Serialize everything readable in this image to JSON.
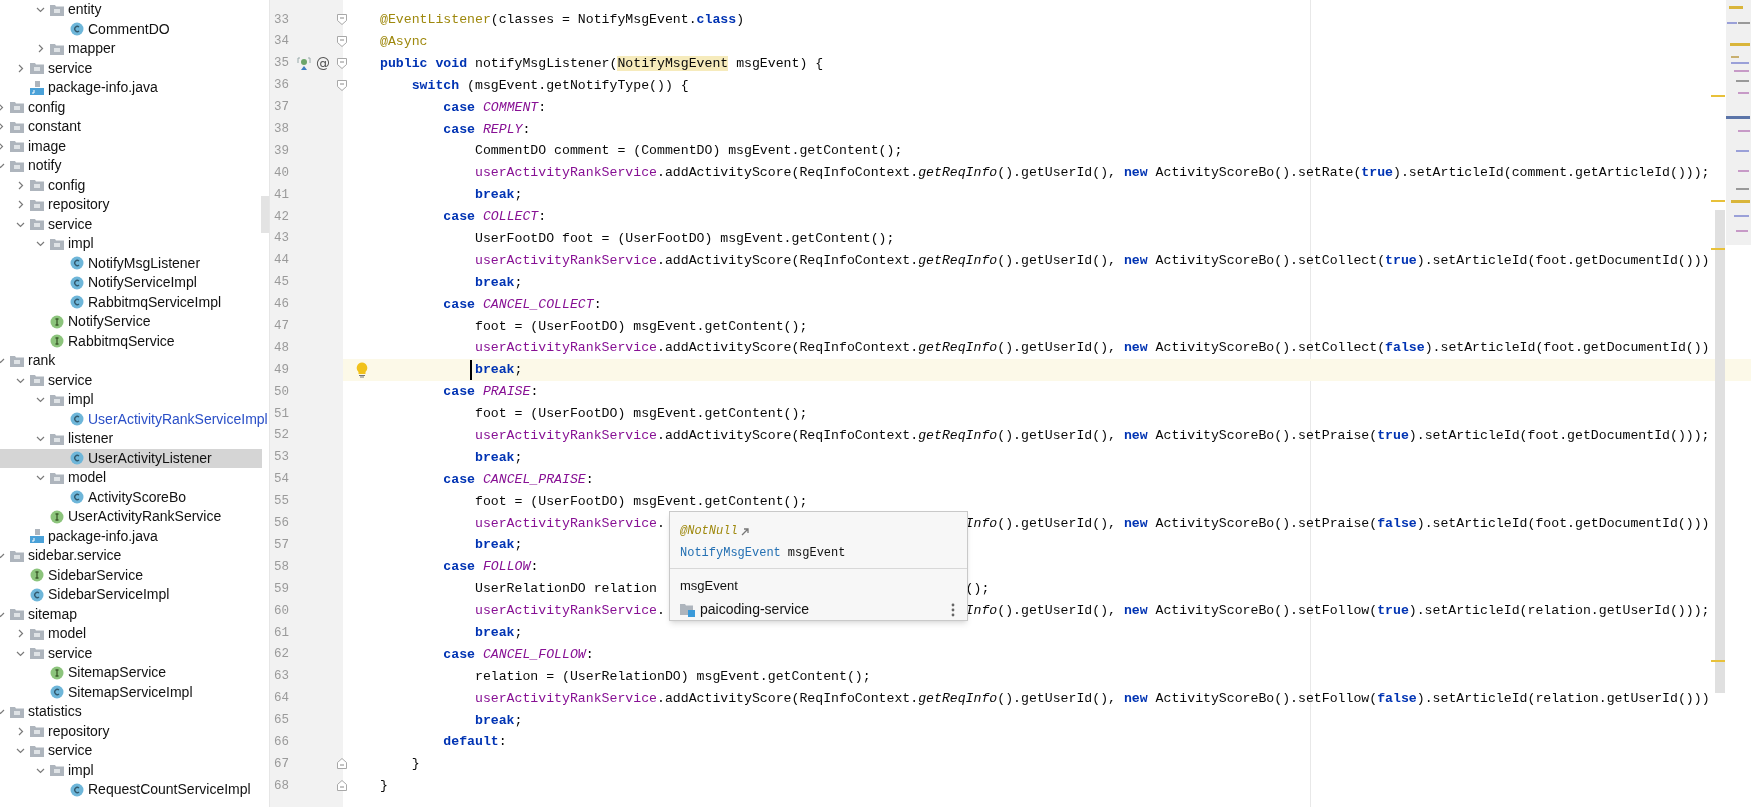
{
  "project_tree": [
    {
      "children": [
        {
          "children": [
            {
              "label": "entity",
              "kind": "folder",
              "expanded": true,
              "selected": false,
              "modified": false,
              "children": [
                {
                  "label": "CommentDO",
                  "kind": "class",
                  "selected": false,
                  "modified": false
                }
              ]
            },
            {
              "label": "mapper",
              "kind": "folder",
              "expanded": false,
              "selected": false,
              "modified": false
            }
          ]
        },
        {
          "label": "service",
          "kind": "folder",
          "expanded": false,
          "selected": false,
          "modified": false
        },
        {
          "label": "package-info.java",
          "kind": "file",
          "selected": false,
          "modified": false
        }
      ]
    },
    {
      "label": "config",
      "kind": "folder",
      "expanded": false,
      "selected": false,
      "modified": false
    },
    {
      "label": "constant",
      "kind": "folder",
      "expanded": false,
      "selected": false,
      "modified": false
    },
    {
      "label": "image",
      "kind": "folder",
      "expanded": false,
      "selected": false,
      "modified": false
    },
    {
      "label": "notify",
      "kind": "folder",
      "expanded": true,
      "selected": false,
      "modified": false,
      "children": [
        {
          "label": "config",
          "kind": "folder",
          "expanded": false,
          "selected": false,
          "modified": false
        },
        {
          "label": "repository",
          "kind": "folder",
          "expanded": false,
          "selected": false,
          "modified": false
        },
        {
          "label": "service",
          "kind": "folder",
          "expanded": true,
          "selected": false,
          "modified": false,
          "children": [
            {
              "label": "impl",
              "kind": "folder",
              "expanded": true,
              "selected": false,
              "modified": false,
              "children": [
                {
                  "label": "NotifyMsgListener",
                  "kind": "class",
                  "selected": false,
                  "modified": false
                },
                {
                  "label": "NotifyServiceImpl",
                  "kind": "class",
                  "selected": false,
                  "modified": false
                },
                {
                  "label": "RabbitmqServiceImpl",
                  "kind": "class",
                  "selected": false,
                  "modified": false
                }
              ]
            },
            {
              "label": "NotifyService",
              "kind": "interface",
              "selected": false,
              "modified": false
            },
            {
              "label": "RabbitmqService",
              "kind": "interface",
              "selected": false,
              "modified": false
            }
          ]
        }
      ]
    },
    {
      "label": "rank",
      "kind": "folder",
      "expanded": true,
      "selected": false,
      "modified": false,
      "children": [
        {
          "label": "service",
          "kind": "folder",
          "expanded": true,
          "selected": false,
          "modified": false,
          "children": [
            {
              "label": "impl",
              "kind": "folder",
              "expanded": true,
              "selected": false,
              "modified": false,
              "children": [
                {
                  "label": "UserActivityRankServiceImpl",
                  "kind": "class",
                  "selected": false,
                  "modified": true
                }
              ]
            },
            {
              "label": "listener",
              "kind": "folder",
              "expanded": true,
              "selected": false,
              "modified": false,
              "children": [
                {
                  "label": "UserActivityListener",
                  "kind": "class",
                  "selected": true,
                  "modified": false
                }
              ]
            },
            {
              "label": "model",
              "kind": "folder",
              "expanded": true,
              "selected": false,
              "modified": false,
              "children": [
                {
                  "label": "ActivityScoreBo",
                  "kind": "class",
                  "selected": false,
                  "modified": false
                }
              ]
            },
            {
              "label": "UserActivityRankService",
              "kind": "interface",
              "selected": false,
              "modified": false
            }
          ]
        },
        {
          "label": "package-info.java",
          "kind": "file",
          "selected": false,
          "modified": false
        }
      ]
    },
    {
      "label": "sidebar.service",
      "kind": "folder",
      "expanded": true,
      "selected": false,
      "modified": false,
      "children": [
        {
          "label": "SidebarService",
          "kind": "interface",
          "selected": false,
          "modified": false
        },
        {
          "label": "SidebarServiceImpl",
          "kind": "class",
          "selected": false,
          "modified": false
        }
      ]
    },
    {
      "label": "sitemap",
      "kind": "folder",
      "expanded": true,
      "selected": false,
      "modified": false,
      "children": [
        {
          "label": "model",
          "kind": "folder",
          "expanded": false,
          "selected": false,
          "modified": false
        },
        {
          "label": "service",
          "kind": "folder",
          "expanded": true,
          "selected": false,
          "modified": false,
          "children": [
            {
              "label": "SitemapService",
              "kind": "interface",
              "selected": false,
              "modified": false
            },
            {
              "label": "SitemapServiceImpl",
              "kind": "class",
              "selected": false,
              "modified": false
            }
          ]
        }
      ]
    },
    {
      "label": "statistics",
      "kind": "folder",
      "expanded": true,
      "selected": false,
      "modified": false,
      "children": [
        {
          "label": "repository",
          "kind": "folder",
          "expanded": false,
          "selected": false,
          "modified": false
        },
        {
          "label": "service",
          "kind": "folder",
          "expanded": true,
          "selected": false,
          "modified": false,
          "children": [
            {
              "label": "impl",
              "kind": "folder",
              "expanded": true,
              "selected": false,
              "modified": false,
              "children": [
                {
                  "label": "RequestCountServiceImpl",
                  "kind": "class",
                  "selected": false,
                  "modified": false
                }
              ]
            }
          ]
        }
      ]
    }
  ],
  "editor": {
    "lines": [
      {
        "number": "33",
        "current": false,
        "fold_open": true,
        "code": [
          {
            "text": "@EventListener",
            "kind": "annotation"
          },
          {
            "text": "(classes = NotifyMsgEvent.",
            "kind": "plain"
          },
          {
            "text": "class",
            "kind": "keyword"
          },
          {
            "text": ")",
            "kind": "plain"
          }
        ]
      },
      {
        "number": "34",
        "current": false,
        "fold_open": true,
        "code": [
          {
            "text": "@Async",
            "kind": "annotation"
          }
        ]
      },
      {
        "number": "35",
        "current": false,
        "fold_open": true,
        "gutter_mark": "@",
        "code": [
          {
            "text": "public void ",
            "kind": "keyword"
          },
          {
            "text": "notifyMsgListener(",
            "kind": "plain"
          },
          {
            "text": "NotifyMsgEvent",
            "kind": "highlight"
          },
          {
            "text": " msgEvent) {",
            "kind": "plain"
          }
        ]
      },
      {
        "number": "36",
        "current": false,
        "fold_open": true,
        "code": [
          {
            "text": "    switch",
            "kind": "keyword"
          },
          {
            "text": " (msgEvent.getNotifyType()) {",
            "kind": "plain"
          }
        ]
      },
      {
        "number": "37",
        "current": false,
        "code": [
          {
            "text": "        case ",
            "kind": "keyword"
          },
          {
            "text": "COMMENT",
            "kind": "constant"
          },
          {
            "text": ":",
            "kind": "plain"
          }
        ]
      },
      {
        "number": "38",
        "current": false,
        "code": [
          {
            "text": "        case ",
            "kind": "keyword"
          },
          {
            "text": "REPLY",
            "kind": "constant"
          },
          {
            "text": ":",
            "kind": "plain"
          }
        ]
      },
      {
        "number": "39",
        "current": false,
        "code": [
          {
            "text": "            CommentDO comment = (CommentDO) msgEvent.getContent();",
            "kind": "plain"
          }
        ]
      },
      {
        "number": "40",
        "current": false,
        "code": [
          {
            "text": "            userActivityRankService",
            "kind": "field"
          },
          {
            "text": ".addActivityScore(ReqInfoContext.",
            "kind": "plain"
          },
          {
            "text": "getReqInfo",
            "kind": "static"
          },
          {
            "text": "().getUserId(), ",
            "kind": "plain"
          },
          {
            "text": "new ",
            "kind": "keyword"
          },
          {
            "text": "ActivityScoreBo().setRate(",
            "kind": "plain"
          },
          {
            "text": "true",
            "kind": "keyword"
          },
          {
            "text": ").setArticleId(comment.getArticleId()));",
            "kind": "plain"
          }
        ]
      },
      {
        "number": "41",
        "current": false,
        "code": [
          {
            "text": "            break",
            "kind": "keyword"
          },
          {
            "text": ";",
            "kind": "plain"
          }
        ]
      },
      {
        "number": "42",
        "current": false,
        "code": [
          {
            "text": "        case ",
            "kind": "keyword"
          },
          {
            "text": "COLLECT",
            "kind": "constant"
          },
          {
            "text": ":",
            "kind": "plain"
          }
        ]
      },
      {
        "number": "43",
        "current": false,
        "code": [
          {
            "text": "            UserFootDO foot = (UserFootDO) msgEvent.getContent();",
            "kind": "plain"
          }
        ]
      },
      {
        "number": "44",
        "current": false,
        "code": [
          {
            "text": "            userActivityRankService",
            "kind": "field"
          },
          {
            "text": ".addActivityScore(ReqInfoContext.",
            "kind": "plain"
          },
          {
            "text": "getReqInfo",
            "kind": "static"
          },
          {
            "text": "().getUserId(), ",
            "kind": "plain"
          },
          {
            "text": "new ",
            "kind": "keyword"
          },
          {
            "text": "ActivityScoreBo().setCollect(",
            "kind": "plain"
          },
          {
            "text": "true",
            "kind": "keyword"
          },
          {
            "text": ").setArticleId(foot.getDocumentId()))",
            "kind": "plain"
          }
        ]
      },
      {
        "number": "45",
        "current": false,
        "code": [
          {
            "text": "            break",
            "kind": "keyword"
          },
          {
            "text": ";",
            "kind": "plain"
          }
        ]
      },
      {
        "number": "46",
        "current": false,
        "code": [
          {
            "text": "        case ",
            "kind": "keyword"
          },
          {
            "text": "CANCEL_COLLECT",
            "kind": "constant"
          },
          {
            "text": ":",
            "kind": "plain"
          }
        ]
      },
      {
        "number": "47",
        "current": false,
        "code": [
          {
            "text": "            foot = (UserFootDO) msgEvent.getContent();",
            "kind": "plain"
          }
        ]
      },
      {
        "number": "48",
        "current": false,
        "code": [
          {
            "text": "            userActivityRankService",
            "kind": "field"
          },
          {
            "text": ".addActivityScore(ReqInfoContext.",
            "kind": "plain"
          },
          {
            "text": "getReqInfo",
            "kind": "static"
          },
          {
            "text": "().getUserId(), ",
            "kind": "plain"
          },
          {
            "text": "new ",
            "kind": "keyword"
          },
          {
            "text": "ActivityScoreBo().setCollect(",
            "kind": "plain"
          },
          {
            "text": "false",
            "kind": "keyword"
          },
          {
            "text": ").setArticleId(foot.getDocumentId())",
            "kind": "plain"
          }
        ]
      },
      {
        "number": "49",
        "current": true,
        "code": [
          {
            "text": "            break",
            "kind": "keyword"
          },
          {
            "text": ";",
            "kind": "plain"
          }
        ]
      },
      {
        "number": "50",
        "current": false,
        "code": [
          {
            "text": "        case ",
            "kind": "keyword"
          },
          {
            "text": "PRAISE",
            "kind": "constant"
          },
          {
            "text": ":",
            "kind": "plain"
          }
        ]
      },
      {
        "number": "51",
        "current": false,
        "code": [
          {
            "text": "            foot = (UserFootDO) msgEvent.getContent();",
            "kind": "plain"
          }
        ]
      },
      {
        "number": "52",
        "current": false,
        "code": [
          {
            "text": "            userActivityRankService",
            "kind": "field"
          },
          {
            "text": ".addActivityScore(ReqInfoContext.",
            "kind": "plain"
          },
          {
            "text": "getReqInfo",
            "kind": "static"
          },
          {
            "text": "().getUserId(), ",
            "kind": "plain"
          },
          {
            "text": "new ",
            "kind": "keyword"
          },
          {
            "text": "ActivityScoreBo().setPraise(",
            "kind": "plain"
          },
          {
            "text": "true",
            "kind": "keyword"
          },
          {
            "text": ").setArticleId(foot.getDocumentId()));",
            "kind": "plain"
          }
        ]
      },
      {
        "number": "53",
        "current": false,
        "code": [
          {
            "text": "            break",
            "kind": "keyword"
          },
          {
            "text": ";",
            "kind": "plain"
          }
        ]
      },
      {
        "number": "54",
        "current": false,
        "code": [
          {
            "text": "        case ",
            "kind": "keyword"
          },
          {
            "text": "CANCEL_PRAISE",
            "kind": "constant"
          },
          {
            "text": ":",
            "kind": "plain"
          }
        ]
      },
      {
        "number": "55",
        "current": false,
        "code": [
          {
            "text": "            foot = (UserFootDO) msgEvent.getContent();",
            "kind": "plain"
          }
        ]
      },
      {
        "number": "56",
        "current": false,
        "code": [
          {
            "text": "            userActivityRankService",
            "kind": "field"
          },
          {
            "text": ".",
            "kind": "plain"
          }
        ],
        "code_after_popup": [
          {
            "text": "Info",
            "kind": "static"
          },
          {
            "text": "().getUserId(), ",
            "kind": "plain"
          },
          {
            "text": "new ",
            "kind": "keyword"
          },
          {
            "text": "ActivityScoreBo().setPraise(",
            "kind": "plain"
          },
          {
            "text": "false",
            "kind": "keyword"
          },
          {
            "text": ").setArticleId(foot.getDocumentId()))",
            "kind": "plain"
          }
        ]
      },
      {
        "number": "57",
        "current": false,
        "code": [
          {
            "text": "            break",
            "kind": "keyword"
          },
          {
            "text": ";",
            "kind": "plain"
          }
        ]
      },
      {
        "number": "58",
        "current": false,
        "code": [
          {
            "text": "        case ",
            "kind": "keyword"
          },
          {
            "text": "FOLLOW",
            "kind": "constant"
          },
          {
            "text": ":",
            "kind": "plain"
          }
        ]
      },
      {
        "number": "59",
        "current": false,
        "code": [
          {
            "text": "            UserRelationDO relation",
            "kind": "plain"
          }
        ],
        "code_after_popup": [
          {
            "text": "();",
            "kind": "plain"
          }
        ]
      },
      {
        "number": "60",
        "current": false,
        "code": [
          {
            "text": "            userActivityRankService",
            "kind": "field"
          },
          {
            "text": ".",
            "kind": "plain"
          }
        ],
        "code_after_popup": [
          {
            "text": "Info",
            "kind": "static"
          },
          {
            "text": "().getUserId(), ",
            "kind": "plain"
          },
          {
            "text": "new ",
            "kind": "keyword"
          },
          {
            "text": "ActivityScoreBo().setFollow(",
            "kind": "plain"
          },
          {
            "text": "true",
            "kind": "keyword"
          },
          {
            "text": ").setArticleId(relation.getUserId()));",
            "kind": "plain"
          }
        ]
      },
      {
        "number": "61",
        "current": false,
        "code": [
          {
            "text": "            break",
            "kind": "keyword"
          },
          {
            "text": ";",
            "kind": "plain"
          }
        ]
      },
      {
        "number": "62",
        "current": false,
        "code": [
          {
            "text": "        case ",
            "kind": "keyword"
          },
          {
            "text": "CANCEL_FOLLOW",
            "kind": "constant"
          },
          {
            "text": ":",
            "kind": "plain"
          }
        ]
      },
      {
        "number": "63",
        "current": false,
        "code": [
          {
            "text": "            relation = (UserRelationDO) msgEvent.getContent();",
            "kind": "plain"
          }
        ]
      },
      {
        "number": "64",
        "current": false,
        "code": [
          {
            "text": "            userActivityRankService",
            "kind": "field"
          },
          {
            "text": ".addActivityScore(ReqInfoContext.",
            "kind": "plain"
          },
          {
            "text": "getReqInfo",
            "kind": "static"
          },
          {
            "text": "().getUserId(), ",
            "kind": "plain"
          },
          {
            "text": "new ",
            "kind": "keyword"
          },
          {
            "text": "ActivityScoreBo().setFollow(",
            "kind": "plain"
          },
          {
            "text": "false",
            "kind": "keyword"
          },
          {
            "text": ").setArticleId(relation.getUserId()))",
            "kind": "plain"
          }
        ]
      },
      {
        "number": "65",
        "current": false,
        "code": [
          {
            "text": "            break",
            "kind": "keyword"
          },
          {
            "text": ";",
            "kind": "plain"
          }
        ]
      },
      {
        "number": "66",
        "current": false,
        "code": [
          {
            "text": "        default",
            "kind": "keyword"
          },
          {
            "text": ":",
            "kind": "plain"
          }
        ]
      },
      {
        "number": "67",
        "current": false,
        "fold_close": true,
        "code": [
          {
            "text": "    }",
            "kind": "plain"
          }
        ]
      },
      {
        "number": "68",
        "current": false,
        "fold_close": true,
        "code": [
          {
            "text": "}",
            "kind": "plain"
          }
        ]
      }
    ],
    "popup": {
      "annotation": "@NotNull",
      "type": "NotifyMsgEvent",
      "name": "msgEvent",
      "symbol": "msgEvent",
      "module": "paicoding-service"
    }
  }
}
